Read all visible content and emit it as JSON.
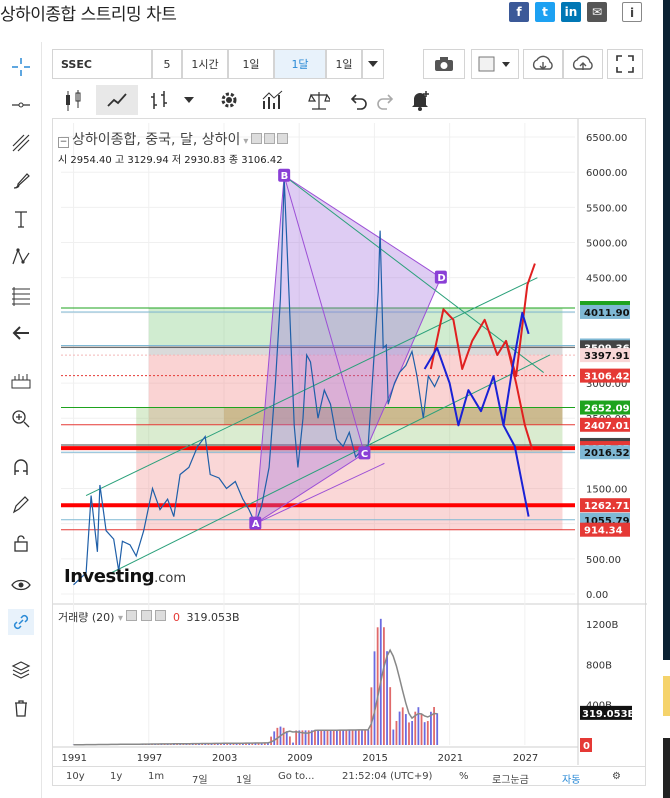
{
  "page": {
    "title": "상하이종합 스트리밍 차트"
  },
  "share": {
    "facebook": "f",
    "twitter": "t",
    "linkedin": "in",
    "mail": "✉",
    "info": "i"
  },
  "toolbar": {
    "symbol": "SSEC",
    "interval_number": "5",
    "intervals": [
      "1시간",
      "1일",
      "1달",
      "1일"
    ],
    "active_interval": "1달"
  },
  "legend": {
    "title": "상하이종합, 중국, 달, 상하이",
    "open_label": "시",
    "open": "2954.40",
    "high_label": "고",
    "high": "3129.94",
    "low_label": "저",
    "low": "2930.83",
    "close_label": "종",
    "close": "3106.42"
  },
  "watermark": {
    "brand": "Investing",
    "suffix": ".com"
  },
  "volume": {
    "label": "거래량 (20)",
    "zero": "0",
    "value": "319.053B"
  },
  "bottom_bar": {
    "ranges": [
      "10y",
      "1y",
      "1m",
      "7일",
      "1일",
      "Go to..."
    ],
    "time": "21:52:04 (UTC+9)",
    "percent": "%",
    "log": "로그눈금",
    "auto": "자동"
  },
  "chart_data": {
    "type": "line",
    "title": "상하이종합, 중국, 달, 상하이",
    "x_ticks": [
      "1991",
      "1997",
      "2003",
      "2009",
      "2015",
      "2021",
      "2027"
    ],
    "y_ticks": [
      "6500.00",
      "6000.00",
      "5500.00",
      "5000.00",
      "4500.00",
      "4000.00",
      "3500.00",
      "3000.00",
      "2500.00",
      "2000.00",
      "1500.00",
      "1000.00",
      "500.00",
      "0.00"
    ],
    "ylim": [
      -100,
      6700
    ],
    "series": [
      {
        "values": [
          [
            1991.0,
            130
          ],
          [
            1992.0,
            300
          ],
          [
            1992.4,
            1400
          ],
          [
            1992.9,
            600
          ],
          [
            1993.1,
            1550
          ],
          [
            1993.6,
            900
          ],
          [
            1994.2,
            780
          ],
          [
            1994.6,
            330
          ],
          [
            1994.9,
            750
          ],
          [
            1995.5,
            700
          ],
          [
            1996.0,
            540
          ],
          [
            1996.6,
            900
          ],
          [
            1997.3,
            1500
          ],
          [
            1997.9,
            1200
          ],
          [
            1998.5,
            1350
          ],
          [
            1999.0,
            1100
          ],
          [
            1999.5,
            1700
          ],
          [
            2000.2,
            1800
          ],
          [
            2000.9,
            2100
          ],
          [
            2001.5,
            2240
          ],
          [
            2001.9,
            1700
          ],
          [
            2002.6,
            1650
          ],
          [
            2003.2,
            1500
          ],
          [
            2003.9,
            1600
          ],
          [
            2004.5,
            1350
          ],
          [
            2005.0,
            1200
          ],
          [
            2005.5,
            1000
          ],
          [
            2006.0,
            1250
          ],
          [
            2006.6,
            1800
          ],
          [
            2007.1,
            3000
          ],
          [
            2007.5,
            4200
          ],
          [
            2007.8,
            5900
          ],
          [
            2008.2,
            4200
          ],
          [
            2008.6,
            2400
          ],
          [
            2008.9,
            1800
          ],
          [
            2009.3,
            2500
          ],
          [
            2009.6,
            3400
          ],
          [
            2009.9,
            3300
          ],
          [
            2010.5,
            2500
          ],
          [
            2011.0,
            2900
          ],
          [
            2011.5,
            2700
          ],
          [
            2012.0,
            2200
          ],
          [
            2012.5,
            2100
          ],
          [
            2013.0,
            2300
          ],
          [
            2013.5,
            1950
          ],
          [
            2014.0,
            2050
          ],
          [
            2014.5,
            2100
          ],
          [
            2014.9,
            3200
          ],
          [
            2015.3,
            4300
          ],
          [
            2015.45,
            5170
          ],
          [
            2015.7,
            3500
          ],
          [
            2015.95,
            3540
          ],
          [
            2016.1,
            2700
          ],
          [
            2016.6,
            3000
          ],
          [
            2017.0,
            3150
          ],
          [
            2017.5,
            3250
          ],
          [
            2018.0,
            3450
          ],
          [
            2018.4,
            3100
          ],
          [
            2018.9,
            2500
          ],
          [
            2019.3,
            3100
          ],
          [
            2019.8,
            2950
          ],
          [
            2020.2,
            3106
          ]
        ]
      }
    ],
    "price_levels": [
      {
        "value": "4068.10",
        "color": "#1ea31e"
      },
      {
        "value": "4011.90",
        "color": "#7fb8d4"
      },
      {
        "value": "3534.91",
        "color": "#7fb8d4"
      },
      {
        "value": "3509.36",
        "color": "#444444"
      },
      {
        "value": "3397.91",
        "color": "#f4b6b6"
      },
      {
        "value": "3106.42",
        "color": "#e53935"
      },
      {
        "value": "2652.09",
        "color": "#1ea31e"
      },
      {
        "value": "2407.01",
        "color": "#e53935"
      },
      {
        "value": "2119.99",
        "color": "#444444"
      },
      {
        "value": "2075.65",
        "color": "#e53935"
      },
      {
        "value": "2016.52",
        "color": "#7fb8d4"
      },
      {
        "value": "1262.71",
        "color": "#e53935"
      },
      {
        "value": "1055.79",
        "color": "#7fb8d4"
      },
      {
        "value": "914.34",
        "color": "#e53935"
      }
    ],
    "pattern_points": [
      {
        "label": "A",
        "x": 2005.5,
        "y": 1000
      },
      {
        "label": "B",
        "x": 2007.8,
        "y": 5950
      },
      {
        "label": "C",
        "x": 2014.2,
        "y": 2000
      },
      {
        "label": "D",
        "x": 2020.3,
        "y": 4500
      }
    ],
    "volume_ticks": [
      "1200B",
      "800B",
      "400B",
      "0"
    ],
    "volume_ylim": [
      0,
      1350
    ],
    "grid": true
  }
}
